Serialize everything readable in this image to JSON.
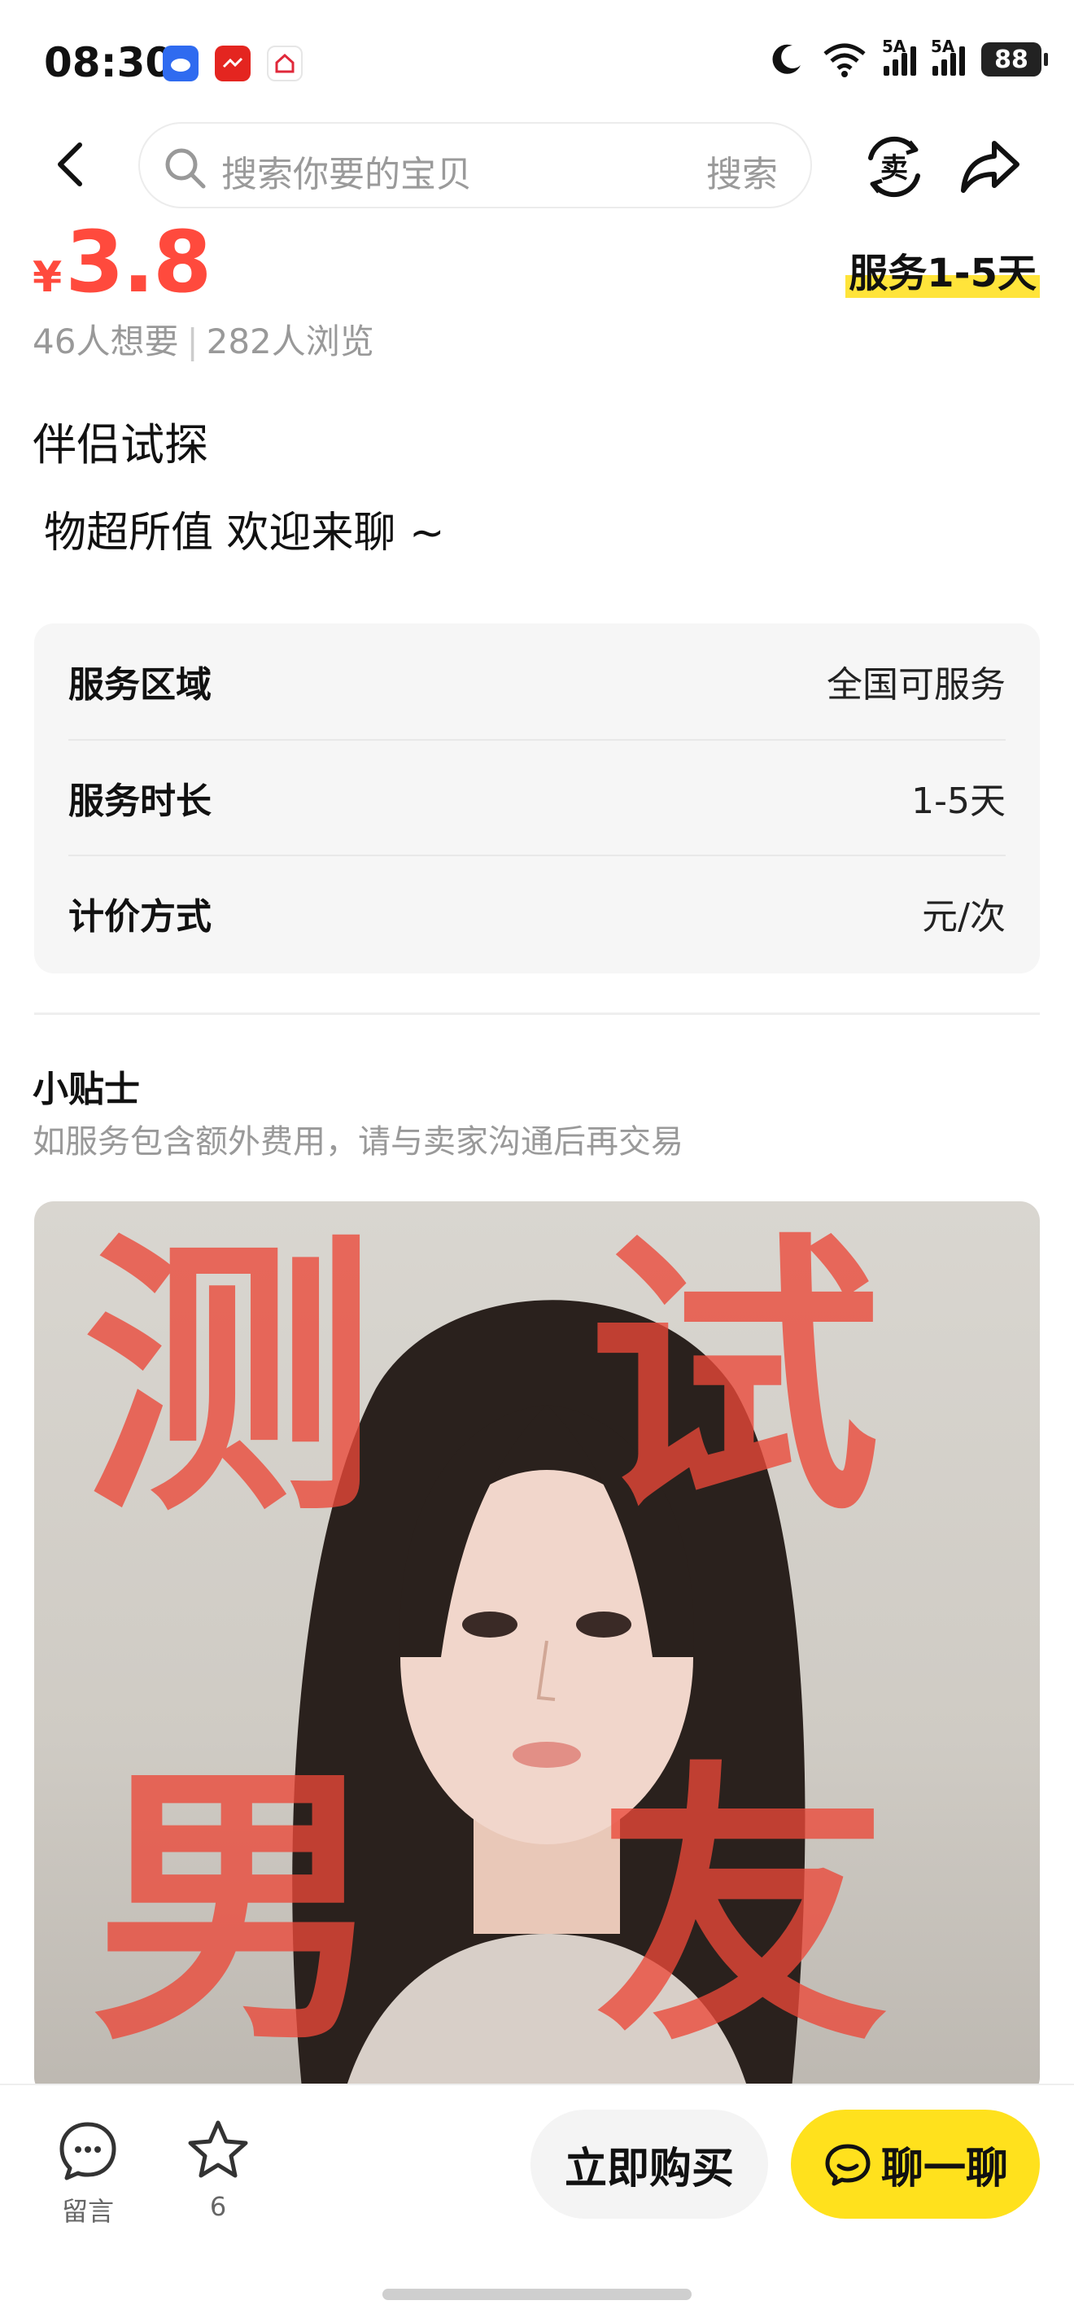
{
  "status_bar": {
    "time": "08:30",
    "sig1": "5A",
    "sig2": "5A",
    "battery": "88"
  },
  "nav": {
    "search_placeholder": "搜索你要的宝贝",
    "search_button": "搜索",
    "sell_label": "卖"
  },
  "product": {
    "currency": "¥",
    "price": "3.8",
    "service_badge": "服务1-5天",
    "wants": "46人想要",
    "views": "282人浏览",
    "title": "伴侣试探",
    "description": "物超所值 欢迎来聊 ~"
  },
  "info": {
    "rows": [
      {
        "key": "服务区域",
        "value": "全国可服务"
      },
      {
        "key": "服务时长",
        "value": "1-5天"
      },
      {
        "key": "计价方式",
        "value": "元/次"
      }
    ]
  },
  "tips": {
    "title": "小贴士",
    "text": "如服务包含额外费用，请与卖家沟通后再交易"
  },
  "photo": {
    "watermark": [
      "测",
      "试",
      "男",
      "友"
    ]
  },
  "bottom_bar": {
    "comment_label": "留言",
    "fav_count": "6",
    "buy_label": "立即购买",
    "chat_label": "聊一聊"
  }
}
